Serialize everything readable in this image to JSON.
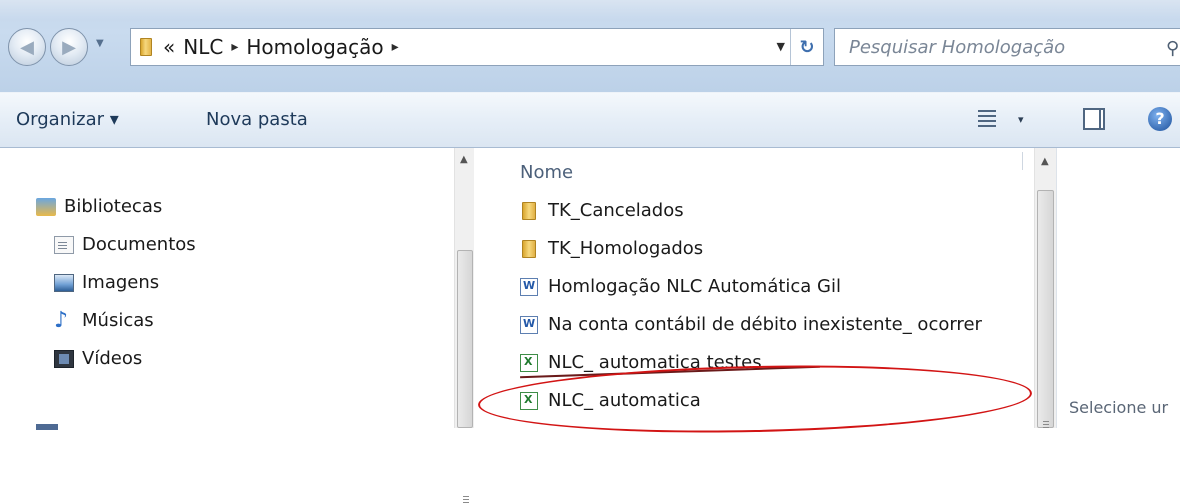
{
  "window": {
    "breadcrumb": {
      "overflow": "«",
      "items": [
        "NLC",
        "Homologação"
      ],
      "separator": "▸"
    },
    "search": {
      "placeholder": "Pesquisar Homologação"
    }
  },
  "toolbar": {
    "organize_label": "Organizar ▾",
    "new_folder_label": "Nova pasta",
    "views_dropdown": "▾",
    "help_label": "?"
  },
  "navigation_pane": {
    "libraries_label": "Bibliotecas",
    "items": [
      {
        "label": "Documentos",
        "icon": "documents-icon"
      },
      {
        "label": "Imagens",
        "icon": "pictures-icon"
      },
      {
        "label": "Músicas",
        "icon": "music-icon"
      },
      {
        "label": "Vídeos",
        "icon": "videos-icon"
      }
    ]
  },
  "file_list": {
    "column_name": "Nome",
    "files": [
      {
        "name": "TK_Cancelados",
        "type": "folder"
      },
      {
        "name": "TK_Homologados",
        "type": "folder"
      },
      {
        "name": "Homlogação NLC Automática Gil",
        "type": "word"
      },
      {
        "name": "Na conta contábil  de débito inexistente_ ocorrer",
        "type": "word"
      },
      {
        "name": "NLC_ automatica testes",
        "type": "excel",
        "struck_through": true
      },
      {
        "name": "NLC_ automatica",
        "type": "excel",
        "circled": true
      }
    ]
  },
  "preview_pane": {
    "text": "Selecione ur"
  },
  "colors": {
    "annotation_red": "#d21414",
    "chrome_blue": "#c9dbef"
  }
}
